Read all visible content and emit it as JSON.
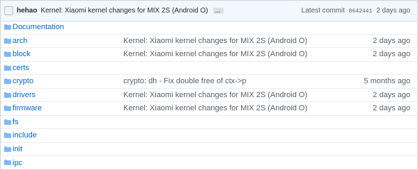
{
  "latest_commit": {
    "author": "hehao",
    "message": "Kernel: Xiaomi kernel changes for MIX 2S (Android O)",
    "ellipsis": "…",
    "label": "Latest commit",
    "sha": "8642441",
    "age": "2 days ago"
  },
  "files": [
    {
      "name": "Documentation",
      "commit": "",
      "age": ""
    },
    {
      "name": "arch",
      "commit": "Kernel: Xiaomi kernel changes for MIX 2S (Android O)",
      "age": "2 days ago"
    },
    {
      "name": "block",
      "commit": "Kernel: Xiaomi kernel changes for MIX 2S (Android O)",
      "age": "2 days ago"
    },
    {
      "name": "certs",
      "commit": "",
      "age": ""
    },
    {
      "name": "crypto",
      "commit": "crypto: dh - Fix double free of ctx->p",
      "age": "5 months ago"
    },
    {
      "name": "drivers",
      "commit": "Kernel: Xiaomi kernel changes for MIX 2S (Android O)",
      "age": "2 days ago"
    },
    {
      "name": "firmware",
      "commit": "Kernel: Xiaomi kernel changes for MIX 2S (Android O)",
      "age": "2 days ago"
    },
    {
      "name": "fs",
      "commit": "",
      "age": ""
    },
    {
      "name": "include",
      "commit": "",
      "age": ""
    },
    {
      "name": "init",
      "commit": "",
      "age": ""
    },
    {
      "name": "ipc",
      "commit": "",
      "age": ""
    }
  ],
  "icons": {
    "folder": "folder-icon",
    "avatar": "avatar"
  },
  "colors": {
    "link": "#0366d6",
    "folder": "#79b8ff",
    "commit_bar": "#f1f8ff"
  }
}
